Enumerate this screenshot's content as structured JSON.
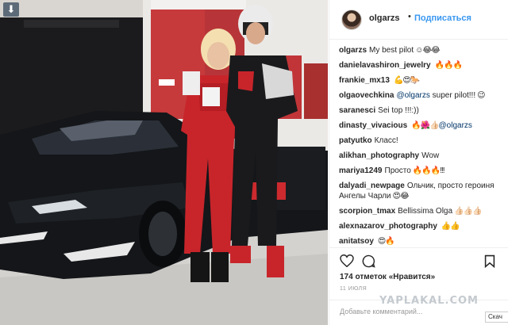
{
  "header": {
    "username": "olgarzs",
    "separator": "•",
    "follow_label": "Подписаться"
  },
  "comments": [
    {
      "user": "olgarzs",
      "text": "My best pilot",
      "emoji": "☺😂😂"
    },
    {
      "user": "danielavashiron_jewelry",
      "text": "",
      "emoji": "🔥🔥🔥"
    },
    {
      "user": "frankie_mx13",
      "text": "",
      "emoji": "💪😍🐎"
    },
    {
      "user": "olgaovechkina",
      "mention": "@olgarzs",
      "text": "super pilot!!!",
      "emoji": "😉"
    },
    {
      "user": "saranesci",
      "text": "Sei top !!!:))",
      "emoji": ""
    },
    {
      "user": "dinasty_vivacious",
      "text": "",
      "emoji": "🔥🌺👍🏻",
      "mention_after": "@olgarzs"
    },
    {
      "user": "patyutko",
      "text": "Класс!",
      "emoji": ""
    },
    {
      "user": "alikhan_photography",
      "text": "Wow",
      "emoji": ""
    },
    {
      "user": "mariya1249",
      "text": "Просто",
      "emoji": "🔥🔥🔥!!!"
    },
    {
      "user": "dalyadi_newpage",
      "text": "Ольчик, просто героиня Ангелы Чарли",
      "emoji": "😍😂"
    },
    {
      "user": "scorpion_tmax",
      "text": "Bellissima Olga",
      "emoji": "👍🏻👍🏻👍🏻"
    },
    {
      "user": "alexnazarov_photography",
      "text": "",
      "emoji": "👍👍"
    },
    {
      "user": "anitatsoy",
      "text": "",
      "emoji": "😍🔥"
    }
  ],
  "actions": {
    "like_icon": "heart-icon",
    "comment_icon": "comment-icon",
    "save_icon": "bookmark-icon"
  },
  "likes_text": "174 отметок «Нравится»",
  "date_text": "11 ИЮЛЯ",
  "add_comment_placeholder": "Добавьте комментарий...",
  "download_button": "Скач",
  "watermark_text": "YAPLAKAL.COM",
  "colors": {
    "link_blue": "#3897f0",
    "mention_blue": "#003569",
    "suit_red": "#c8252b",
    "car_black": "#14161a"
  }
}
